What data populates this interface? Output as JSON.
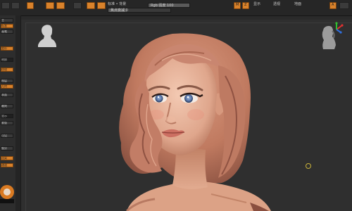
{
  "toolbar": {
    "label_a": "标准 • 背景",
    "slider_focal": "焦点衰减 0",
    "slider_rgb": "Rgb 强度 100",
    "btn_m": "M",
    "btn_z": "Z",
    "btn_a": "A",
    "label_display": "显示",
    "label_persp": "透视",
    "label_floor": "地面"
  },
  "left_tray": {
    "items": [
      "主",
      "标准",
      "画笔",
      "变形",
      "材质",
      "纹理",
      "图层",
      "几何",
      "表面",
      "雕刻",
      "显示",
      "蒙版",
      "可见",
      "细分",
      "渲染",
      "通道"
    ]
  },
  "icons": {
    "bust": "bust-silhouette-icon",
    "gizmo": "navigation-gizmo-icon",
    "cursor": "brush-cursor-ring"
  },
  "colors": {
    "accent": "#d9822b",
    "background": "#2f2f2f",
    "skin": "#d79a7e",
    "hair": "#c5826b"
  }
}
